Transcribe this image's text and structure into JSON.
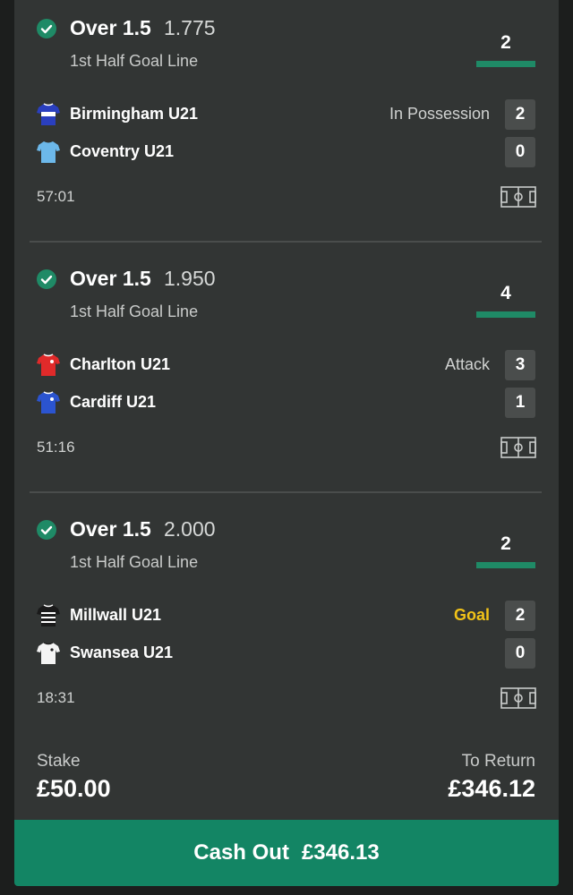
{
  "selections": [
    {
      "market": "Over 1.5",
      "odds": "1.775",
      "subtitle": "1st Half Goal Line",
      "total_goals": "2",
      "home": {
        "name": "Birmingham U21",
        "score": "2",
        "kit": "birmingham-kit-icon",
        "status": "In Possession"
      },
      "away": {
        "name": "Coventry U21",
        "score": "0",
        "kit": "coventry-kit-icon"
      },
      "time": "57:01"
    },
    {
      "market": "Over 1.5",
      "odds": "1.950",
      "subtitle": "1st Half Goal Line",
      "total_goals": "4",
      "home": {
        "name": "Charlton U21",
        "score": "3",
        "kit": "charlton-kit-icon",
        "status": "Attack"
      },
      "away": {
        "name": "Cardiff U21",
        "score": "1",
        "kit": "cardiff-kit-icon"
      },
      "time": "51:16"
    },
    {
      "market": "Over 1.5",
      "odds": "2.000",
      "subtitle": "1st Half Goal Line",
      "total_goals": "2",
      "home": {
        "name": "Millwall U21",
        "score": "2",
        "kit": "millwall-kit-icon",
        "status": "Goal"
      },
      "away": {
        "name": "Swansea U21",
        "score": "0",
        "kit": "swansea-kit-icon"
      },
      "time": "18:31"
    }
  ],
  "footer": {
    "stake_label": "Stake",
    "stake_value": "£50.00",
    "return_label": "To Return",
    "return_value": "£346.12"
  },
  "cashout": {
    "label": "Cash Out",
    "amount": "£346.13"
  },
  "colors": {
    "accent_green": "#138564",
    "goal_yellow": "#f2c318",
    "card_bg": "#323534",
    "page_bg": "#1c1e1d"
  }
}
